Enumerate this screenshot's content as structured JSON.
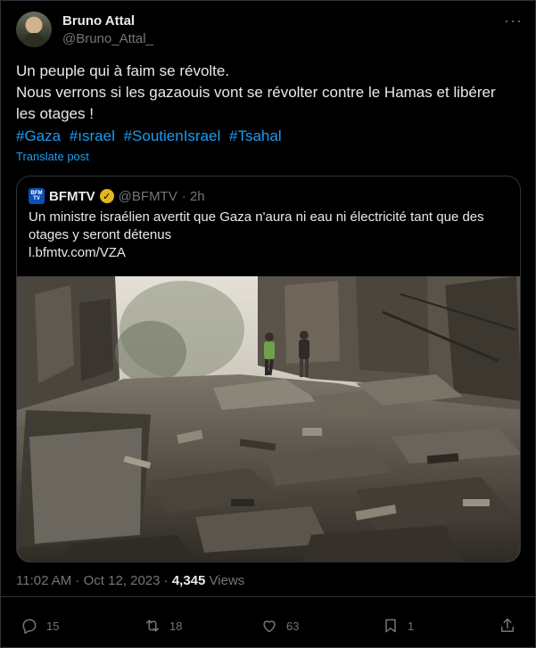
{
  "author": {
    "display_name": "Bruno Attal",
    "handle": "@Bruno_Attal_"
  },
  "more_label": "···",
  "tweet": {
    "lines": [
      "Un peuple qui à faim se révolte.",
      "Nous verrons si les gazaouis vont se révolter contre le Hamas et libérer",
      "les otages !"
    ],
    "hashtags": [
      "#Gaza",
      "#ısrael",
      "#SoutienIsrael",
      "#Tsahal"
    ],
    "translate_label": "Translate post"
  },
  "quote": {
    "logo_text": "BFM TV",
    "name": "BFMTV",
    "handle": "@BFMTV",
    "time": "· 2h",
    "text": "Un ministre israélien avertit que Gaza n'aura ni eau ni électricité tant que des otages y seront détenus",
    "link": "l.bfmtv.com/VZA",
    "image_alt": "Street destroyed by bombing, rubble and debris, two people standing in the ruins"
  },
  "meta": {
    "time": "11:02 AM · Oct 12, 2023 · ",
    "views_count": "4,345",
    "views_label": " Views"
  },
  "actions": {
    "replies": "15",
    "reposts": "18",
    "likes": "63",
    "bookmarks": "1"
  },
  "colors": {
    "background": "#000000",
    "text": "#e7e9ea",
    "muted": "#71767b",
    "link": "#1d9bf0",
    "border": "#2f3336",
    "verified_gold": "#e2b719"
  }
}
